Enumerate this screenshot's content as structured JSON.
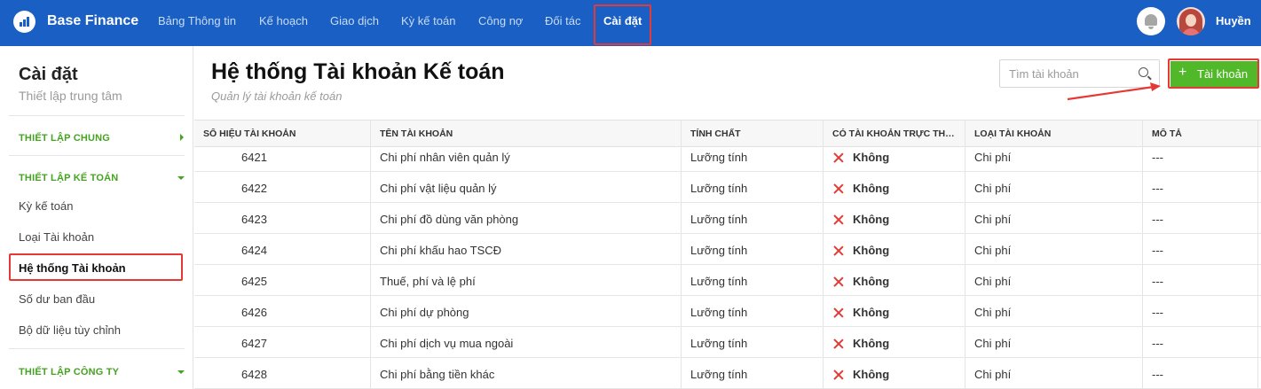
{
  "app": {
    "name": "Base Finance"
  },
  "nav": [
    {
      "label": "Bảng Thông tin"
    },
    {
      "label": "Kế hoạch"
    },
    {
      "label": "Giao dịch"
    },
    {
      "label": "Kỳ kế toán"
    },
    {
      "label": "Công nợ"
    },
    {
      "label": "Đối tác"
    },
    {
      "label": "Cài đặt",
      "active": true
    }
  ],
  "user": {
    "name": "Huyền",
    "avatar": "avatar-woman"
  },
  "icons": {
    "bell": "bell-icon",
    "search": "search-icon",
    "add": "plus-icon",
    "no": "x-icon"
  },
  "colors": {
    "topbar": "#1a5fc4",
    "accent_green": "#51b82a",
    "section_green": "#45a321",
    "highlight_red": "#e53935"
  },
  "sidebar": {
    "title": "Cài đặt",
    "subtitle": "Thiết lập trung tâm",
    "sections": [
      {
        "label": "THIẾT LẬP CHUNG",
        "expanded": false
      },
      {
        "label": "THIẾT LẬP KẾ TOÁN",
        "expanded": true
      },
      {
        "label": "THIẾT LẬP CÔNG TY",
        "expanded": true
      }
    ],
    "items": [
      {
        "label": "Kỳ kế toán"
      },
      {
        "label": "Loại Tài khoản"
      },
      {
        "label": "Hệ thống Tài khoản",
        "active": true
      },
      {
        "label": "Số dư ban đầu"
      },
      {
        "label": "Bộ dữ liệu tùy chỉnh"
      }
    ]
  },
  "page": {
    "title": "Hệ thống Tài khoản Kế toán",
    "subtitle": "Quản lý tài khoản kế toán",
    "search_placeholder": "Tìm tài khoản",
    "add_button": "Tài khoản"
  },
  "table": {
    "columns": [
      "SỐ HIỆU TÀI KHOẢN",
      "TÊN TÀI KHOẢN",
      "TÍNH CHẤT",
      "CÓ TÀI KHOẢN TRỰC THUỘC",
      "LOẠI TÀI KHOẢN",
      "MÔ TẢ"
    ],
    "rows": [
      {
        "code": "6421",
        "name": "Chi phí nhân viên quản lý",
        "nature": "Lưỡng tính",
        "has_sub": "Không",
        "type": "Chi phí",
        "desc": "---"
      },
      {
        "code": "6422",
        "name": "Chi phí vật liệu quản lý",
        "nature": "Lưỡng tính",
        "has_sub": "Không",
        "type": "Chi phí",
        "desc": "---"
      },
      {
        "code": "6423",
        "name": "Chi phí đồ dùng văn phòng",
        "nature": "Lưỡng tính",
        "has_sub": "Không",
        "type": "Chi phí",
        "desc": "---"
      },
      {
        "code": "6424",
        "name": "Chi phí khấu hao TSCĐ",
        "nature": "Lưỡng tính",
        "has_sub": "Không",
        "type": "Chi phí",
        "desc": "---"
      },
      {
        "code": "6425",
        "name": "Thuế, phí và lệ phí",
        "nature": "Lưỡng tính",
        "has_sub": "Không",
        "type": "Chi phí",
        "desc": "---"
      },
      {
        "code": "6426",
        "name": "Chi phí dự phòng",
        "nature": "Lưỡng tính",
        "has_sub": "Không",
        "type": "Chi phí",
        "desc": "---"
      },
      {
        "code": "6427",
        "name": "Chi phí dịch vụ mua ngoài",
        "nature": "Lưỡng tính",
        "has_sub": "Không",
        "type": "Chi phí",
        "desc": "---"
      },
      {
        "code": "6428",
        "name": "Chi phí bằng tiền khác",
        "nature": "Lưỡng tính",
        "has_sub": "Không",
        "type": "Chi phí",
        "desc": "---"
      }
    ]
  }
}
